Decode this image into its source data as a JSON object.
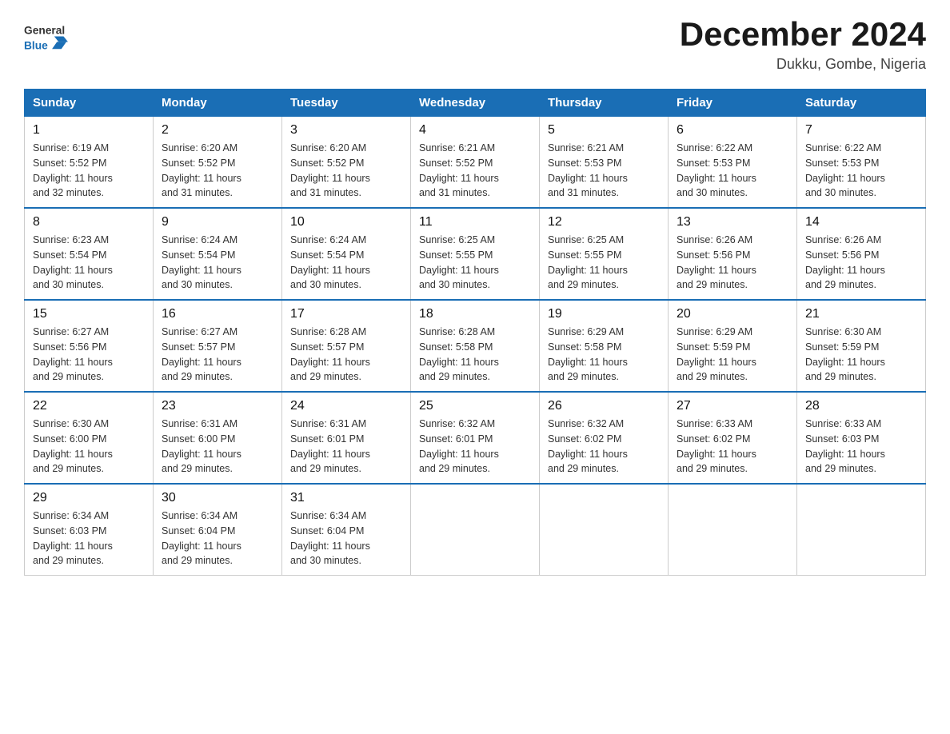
{
  "header": {
    "logo_text_general": "General",
    "logo_text_blue": "Blue",
    "main_title": "December 2024",
    "subtitle": "Dukku, Gombe, Nigeria"
  },
  "days_of_week": [
    "Sunday",
    "Monday",
    "Tuesday",
    "Wednesday",
    "Thursday",
    "Friday",
    "Saturday"
  ],
  "weeks": [
    [
      {
        "day": "1",
        "sunrise": "6:19 AM",
        "sunset": "5:52 PM",
        "daylight": "11 hours and 32 minutes."
      },
      {
        "day": "2",
        "sunrise": "6:20 AM",
        "sunset": "5:52 PM",
        "daylight": "11 hours and 31 minutes."
      },
      {
        "day": "3",
        "sunrise": "6:20 AM",
        "sunset": "5:52 PM",
        "daylight": "11 hours and 31 minutes."
      },
      {
        "day": "4",
        "sunrise": "6:21 AM",
        "sunset": "5:52 PM",
        "daylight": "11 hours and 31 minutes."
      },
      {
        "day": "5",
        "sunrise": "6:21 AM",
        "sunset": "5:53 PM",
        "daylight": "11 hours and 31 minutes."
      },
      {
        "day": "6",
        "sunrise": "6:22 AM",
        "sunset": "5:53 PM",
        "daylight": "11 hours and 30 minutes."
      },
      {
        "day": "7",
        "sunrise": "6:22 AM",
        "sunset": "5:53 PM",
        "daylight": "11 hours and 30 minutes."
      }
    ],
    [
      {
        "day": "8",
        "sunrise": "6:23 AM",
        "sunset": "5:54 PM",
        "daylight": "11 hours and 30 minutes."
      },
      {
        "day": "9",
        "sunrise": "6:24 AM",
        "sunset": "5:54 PM",
        "daylight": "11 hours and 30 minutes."
      },
      {
        "day": "10",
        "sunrise": "6:24 AM",
        "sunset": "5:54 PM",
        "daylight": "11 hours and 30 minutes."
      },
      {
        "day": "11",
        "sunrise": "6:25 AM",
        "sunset": "5:55 PM",
        "daylight": "11 hours and 30 minutes."
      },
      {
        "day": "12",
        "sunrise": "6:25 AM",
        "sunset": "5:55 PM",
        "daylight": "11 hours and 29 minutes."
      },
      {
        "day": "13",
        "sunrise": "6:26 AM",
        "sunset": "5:56 PM",
        "daylight": "11 hours and 29 minutes."
      },
      {
        "day": "14",
        "sunrise": "6:26 AM",
        "sunset": "5:56 PM",
        "daylight": "11 hours and 29 minutes."
      }
    ],
    [
      {
        "day": "15",
        "sunrise": "6:27 AM",
        "sunset": "5:56 PM",
        "daylight": "11 hours and 29 minutes."
      },
      {
        "day": "16",
        "sunrise": "6:27 AM",
        "sunset": "5:57 PM",
        "daylight": "11 hours and 29 minutes."
      },
      {
        "day": "17",
        "sunrise": "6:28 AM",
        "sunset": "5:57 PM",
        "daylight": "11 hours and 29 minutes."
      },
      {
        "day": "18",
        "sunrise": "6:28 AM",
        "sunset": "5:58 PM",
        "daylight": "11 hours and 29 minutes."
      },
      {
        "day": "19",
        "sunrise": "6:29 AM",
        "sunset": "5:58 PM",
        "daylight": "11 hours and 29 minutes."
      },
      {
        "day": "20",
        "sunrise": "6:29 AM",
        "sunset": "5:59 PM",
        "daylight": "11 hours and 29 minutes."
      },
      {
        "day": "21",
        "sunrise": "6:30 AM",
        "sunset": "5:59 PM",
        "daylight": "11 hours and 29 minutes."
      }
    ],
    [
      {
        "day": "22",
        "sunrise": "6:30 AM",
        "sunset": "6:00 PM",
        "daylight": "11 hours and 29 minutes."
      },
      {
        "day": "23",
        "sunrise": "6:31 AM",
        "sunset": "6:00 PM",
        "daylight": "11 hours and 29 minutes."
      },
      {
        "day": "24",
        "sunrise": "6:31 AM",
        "sunset": "6:01 PM",
        "daylight": "11 hours and 29 minutes."
      },
      {
        "day": "25",
        "sunrise": "6:32 AM",
        "sunset": "6:01 PM",
        "daylight": "11 hours and 29 minutes."
      },
      {
        "day": "26",
        "sunrise": "6:32 AM",
        "sunset": "6:02 PM",
        "daylight": "11 hours and 29 minutes."
      },
      {
        "day": "27",
        "sunrise": "6:33 AM",
        "sunset": "6:02 PM",
        "daylight": "11 hours and 29 minutes."
      },
      {
        "day": "28",
        "sunrise": "6:33 AM",
        "sunset": "6:03 PM",
        "daylight": "11 hours and 29 minutes."
      }
    ],
    [
      {
        "day": "29",
        "sunrise": "6:34 AM",
        "sunset": "6:03 PM",
        "daylight": "11 hours and 29 minutes."
      },
      {
        "day": "30",
        "sunrise": "6:34 AM",
        "sunset": "6:04 PM",
        "daylight": "11 hours and 29 minutes."
      },
      {
        "day": "31",
        "sunrise": "6:34 AM",
        "sunset": "6:04 PM",
        "daylight": "11 hours and 30 minutes."
      },
      null,
      null,
      null,
      null
    ]
  ],
  "labels": {
    "sunrise": "Sunrise:",
    "sunset": "Sunset:",
    "daylight": "Daylight:"
  }
}
